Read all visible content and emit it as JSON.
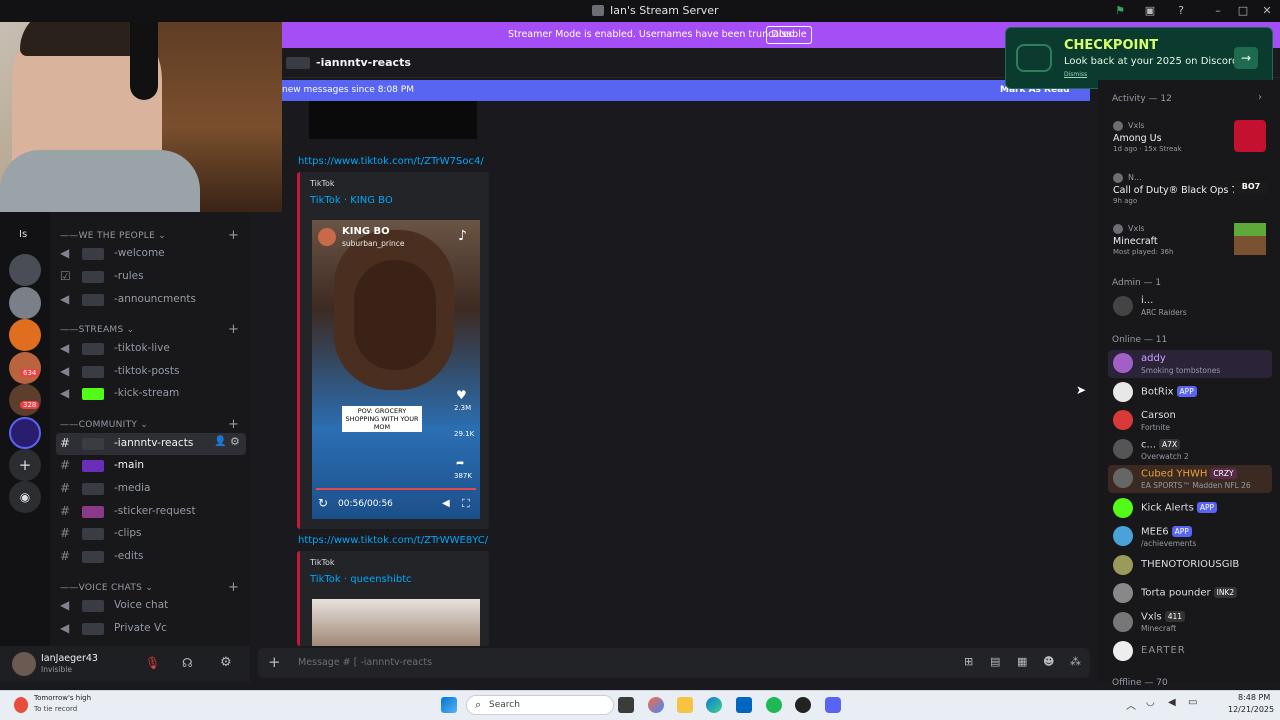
{
  "window": {
    "title": "Ian's Stream Server"
  },
  "banner": {
    "message": "Streamer Mode is enabled. Usernames have been truncated.",
    "button": "Disable"
  },
  "channel_header": {
    "name": "-iannntv-reacts"
  },
  "new_messages": {
    "text": "new messages since 8:08 PM",
    "mark_read": "Mark As Read"
  },
  "checkpoint": {
    "title": "CHECKPOINT",
    "subtitle": "Look back at your 2025 on Discord",
    "dismiss": "Dismiss"
  },
  "rail": {
    "top_label": "Is",
    "badges": [
      "634",
      "328"
    ]
  },
  "sidebar": {
    "categories": [
      {
        "name": "WE THE PEOPLE",
        "channels": [
          "-welcome",
          "-rules",
          "-announcments"
        ]
      },
      {
        "name": "STREAMS",
        "channels": [
          "-tiktok-live",
          "-tiktok-posts",
          "-kick-stream"
        ]
      },
      {
        "name": "COMMUNITY",
        "channels": [
          "-iannntv-reacts",
          "-main",
          "-media",
          "-sticker-request",
          "-clips",
          "-edits"
        ]
      },
      {
        "name": "VOICE CHATS",
        "channels": [
          "Voice chat",
          "Private Vc"
        ]
      }
    ]
  },
  "user_panel": {
    "name": "IanJaeger43",
    "status": "Invisible"
  },
  "messages": [
    {
      "link": "https://www.tiktok.com/t/ZTrW7Soc4/",
      "provider": "TikTok",
      "title": "TikTok · KING BO",
      "video": {
        "creator": "KING BO",
        "handle": "suburban_prince",
        "caption": "POV: GROCERY SHOPPING WITH YOUR MOM",
        "likes": "2.3M",
        "comments": "29.1K",
        "shares": "387K",
        "time": "00:56/00:56"
      }
    },
    {
      "link": "https://www.tiktok.com/t/ZTrWWE8YC/",
      "provider": "TikTok",
      "title": "TikTok · queenshibtc"
    }
  ],
  "composer": {
    "placeholder": "Message # [ -iannntv-reacts"
  },
  "members": {
    "activity_header": "Activity — 12",
    "activities": [
      {
        "user": "Vxls",
        "game": "Among Us",
        "meta": "1d ago · 15x Streak"
      },
      {
        "user": "N...",
        "game": "Call of Duty® Black Ops 7",
        "meta": "9h ago"
      },
      {
        "user": "Vxls",
        "game": "Minecraft",
        "meta": "Most played: 36h"
      }
    ],
    "admin_header": "Admin — 1",
    "admin": [
      {
        "name": "i...",
        "sub": "ARC Raiders"
      }
    ],
    "online_header": "Online — 11",
    "online": [
      {
        "name": "addy",
        "sub": "Smoking tombstones",
        "color": "#c9a3ff"
      },
      {
        "name": "BotRix",
        "tag": "APP",
        "sub": "",
        "color": "#dbdee1"
      },
      {
        "name": "Carson",
        "sub": "Fortnite",
        "color": "#dbdee1"
      },
      {
        "name": "c...",
        "tag": "A7X",
        "sub": "Overwatch 2",
        "color": "#dbdee1"
      },
      {
        "name": "Cubed YHWH",
        "tag": "CRZY",
        "sub": "EA SPORTS™ Madden NFL 26",
        "color": "#e8a23a"
      },
      {
        "name": "Kick Alerts",
        "tag": "APP",
        "sub": "",
        "color": "#dbdee1"
      },
      {
        "name": "MEE6",
        "tag": "APP",
        "sub": "/achievements",
        "color": "#dbdee1"
      },
      {
        "name": "THENOTORIOUSGIB",
        "sub": "",
        "color": "#dbdee1"
      },
      {
        "name": "Torta pounder",
        "tag": "INK2",
        "sub": "",
        "color": "#dbdee1"
      },
      {
        "name": "Vxls",
        "tag": "411",
        "sub": "Minecraft",
        "color": "#dbdee1"
      },
      {
        "name": "EARTER",
        "sub": "",
        "color": "#8e9297"
      }
    ],
    "offline_header": "Offline — 70"
  },
  "taskbar": {
    "weather": {
      "line1": "Tomorrow's high",
      "line2": "To tie record"
    },
    "search": "Search",
    "clock": {
      "time": "8:48 PM",
      "date": "12/21/2025"
    }
  }
}
